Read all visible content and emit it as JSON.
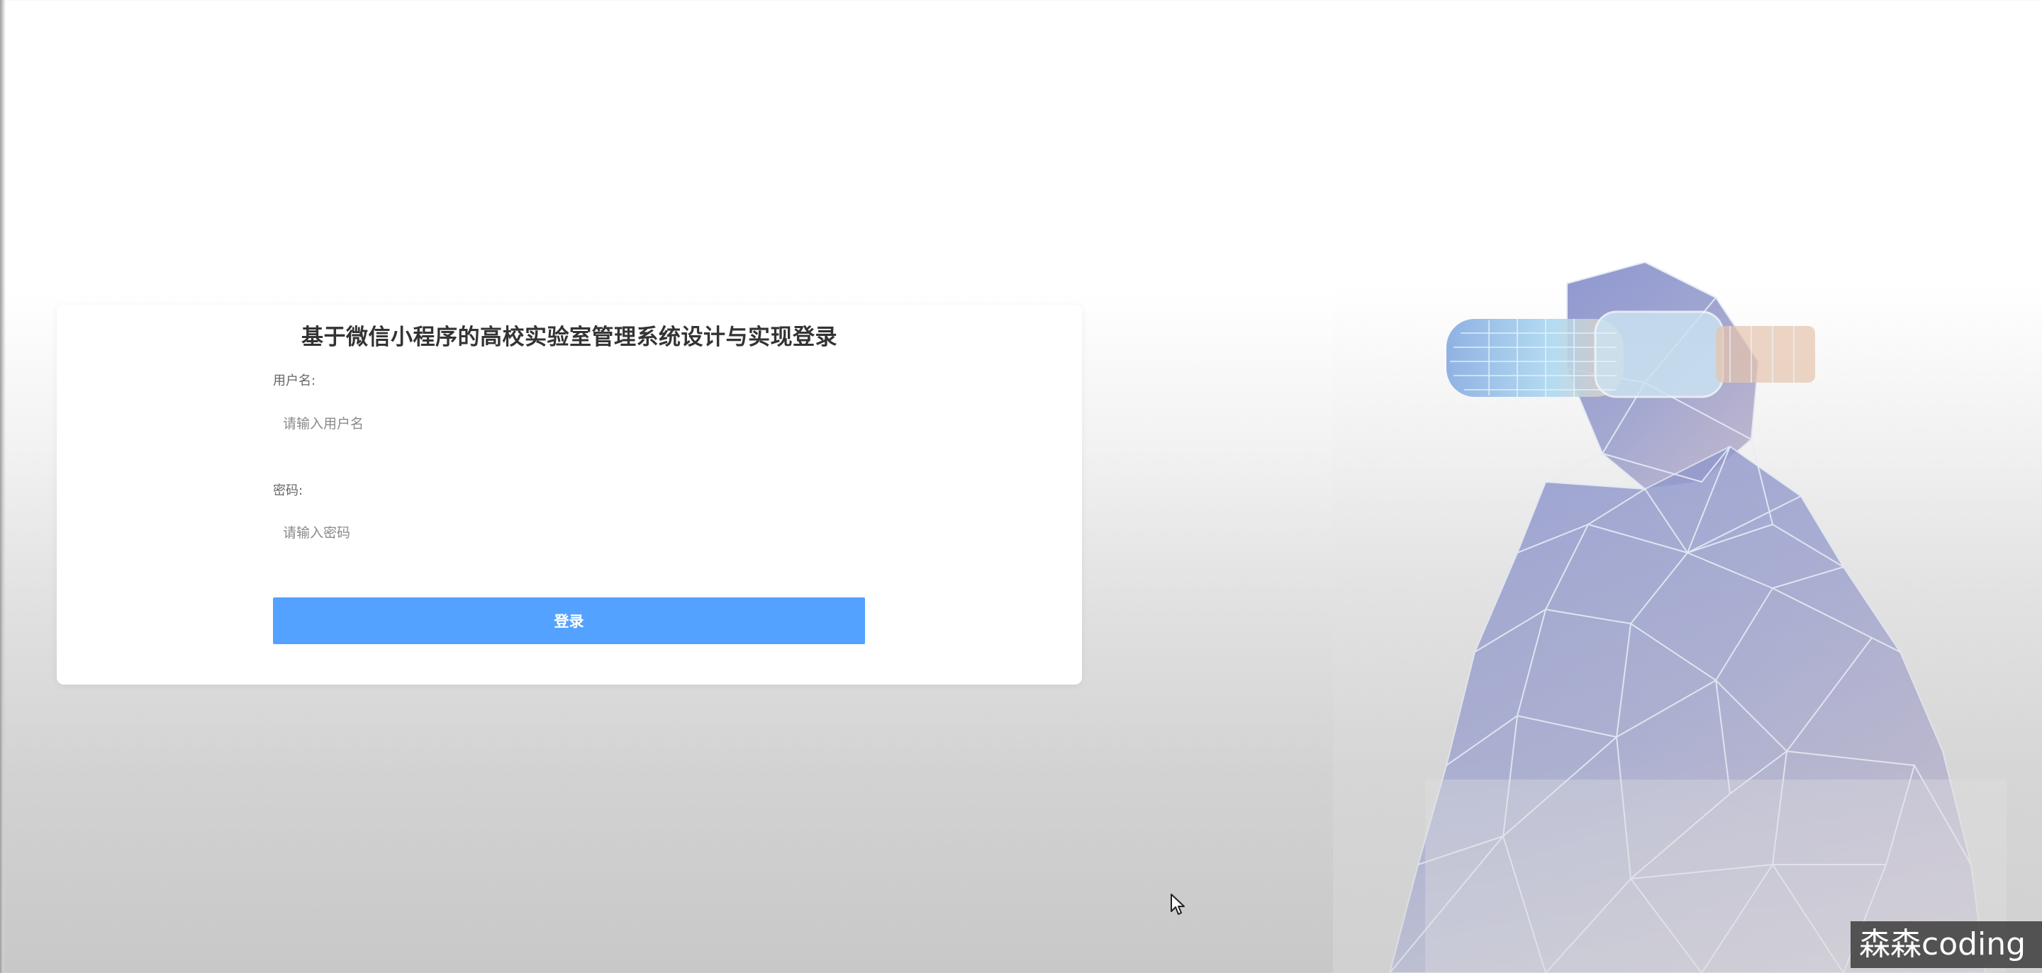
{
  "login": {
    "title": "基于微信小程序的高校实验室管理系统设计与实现登录",
    "username_label": "用户名:",
    "username_placeholder": "请输入用户名",
    "password_label": "密码:",
    "password_placeholder": "请输入密码",
    "submit_label": "登录"
  },
  "colors": {
    "button": "#53a2ff",
    "title": "#333333",
    "label": "#666666"
  },
  "illustration": {
    "icon": "vr-headset-person-illustration"
  },
  "watermark": {
    "text": "森森coding"
  }
}
